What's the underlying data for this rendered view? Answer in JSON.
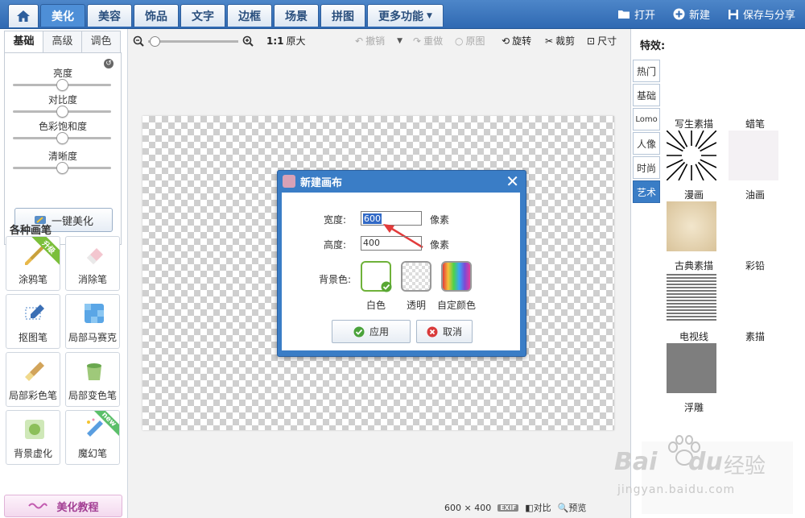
{
  "top_nav": {
    "tabs": [
      {
        "label": "美化",
        "active": true
      },
      {
        "label": "美容"
      },
      {
        "label": "饰品"
      },
      {
        "label": "文字"
      },
      {
        "label": "边框"
      },
      {
        "label": "场景"
      },
      {
        "label": "拼图"
      },
      {
        "label": "更多功能"
      }
    ],
    "actions": {
      "open": "打开",
      "new": "新建",
      "save_share": "保存与分享"
    }
  },
  "left_panel": {
    "tabs": [
      "基础",
      "高级",
      "调色"
    ],
    "sliders": [
      {
        "label": "亮度",
        "value": 0.5
      },
      {
        "label": "对比度",
        "value": 0.5
      },
      {
        "label": "色彩饱和度",
        "value": 0.5
      },
      {
        "label": "清晰度",
        "value": 0.5
      }
    ],
    "one_key_label": "一键美化",
    "brushes_title": "各种画笔",
    "brushes": [
      {
        "label": "涂鸦笔",
        "badge": "升级"
      },
      {
        "label": "消除笔"
      },
      {
        "label": "抠图笔"
      },
      {
        "label": "局部马赛克"
      },
      {
        "label": "局部彩色笔"
      },
      {
        "label": "局部变色笔"
      },
      {
        "label": "背景虚化"
      },
      {
        "label": "魔幻笔",
        "badge": "new"
      }
    ],
    "tutorial_label": "美化教程"
  },
  "toolbar": {
    "zoom_ratio": "1:1",
    "original_size": "原大",
    "undo": "撤销",
    "redo": "重做",
    "original": "原图",
    "rotate": "旋转",
    "crop": "裁剪",
    "size": "尺寸"
  },
  "dialog": {
    "title": "新建画布",
    "width_label": "宽度:",
    "width_value": "600",
    "height_label": "高度:",
    "height_value": "400",
    "unit": "像素",
    "bg_label": "背景色:",
    "bg_options": [
      "白色",
      "透明",
      "自定颜色"
    ],
    "apply": "应用",
    "cancel": "取消"
  },
  "right_panel": {
    "title": "特效:",
    "tabs": [
      "热门",
      "基础",
      "Lomo",
      "人像",
      "时尚",
      "艺术"
    ],
    "effects": [
      "写生素描",
      "蜡笔",
      "漫画",
      "油画",
      "古典素描",
      "彩铅",
      "电视线",
      "素描",
      "浮雕"
    ]
  },
  "status_bar": {
    "dimensions": "600 × 400",
    "exif": "EXIF",
    "compare": "对比",
    "preview": "预览"
  },
  "watermark": {
    "brand": "Bai",
    "brand2": "du",
    "cn": "经验",
    "url": "jingyan.baidu.com"
  }
}
